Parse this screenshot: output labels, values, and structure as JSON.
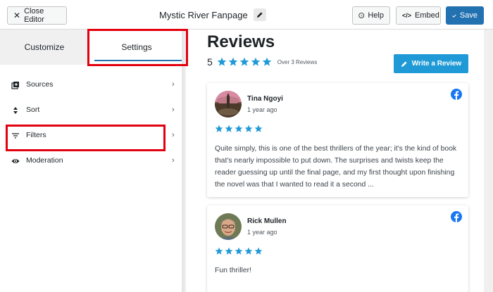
{
  "topbar": {
    "close_label": "Close Editor",
    "page_title": "Mystic River Fanpage",
    "help_label": "Help",
    "embed_label": "Embed",
    "save_label": "Save"
  },
  "sidebar": {
    "tabs": [
      {
        "label": "Customize",
        "active": false
      },
      {
        "label": "Settings",
        "active": true
      }
    ],
    "items": [
      {
        "label": "Sources",
        "icon": "sources-icon"
      },
      {
        "label": "Sort",
        "icon": "sort-icon"
      },
      {
        "label": "Filters",
        "icon": "filter-icon"
      },
      {
        "label": "Moderation",
        "icon": "eye-icon"
      }
    ]
  },
  "main": {
    "title": "Reviews",
    "rating": "5",
    "rating_count": "Over 3 Reviews",
    "write_review_label": "Write a Review",
    "reviews": [
      {
        "name": "Tina Ngoyi",
        "date": "1 year ago",
        "stars": 5,
        "text": "Quite simply, this is one of the best thrillers of the year; it's the kind of book that's nearly impossible to put down. The surprises and twists keep the reader guessing up until the final page, and my first thought upon finishing the novel was that I wanted to read it a second ..."
      },
      {
        "name": "Rick Mullen",
        "date": "1 year ago",
        "stars": 5,
        "text": "Fun thriller!"
      }
    ]
  },
  "colors": {
    "accent": "#2271b1",
    "star": "#1f9ad6",
    "highlight": "#e3000f",
    "facebook": "#1877f2"
  }
}
